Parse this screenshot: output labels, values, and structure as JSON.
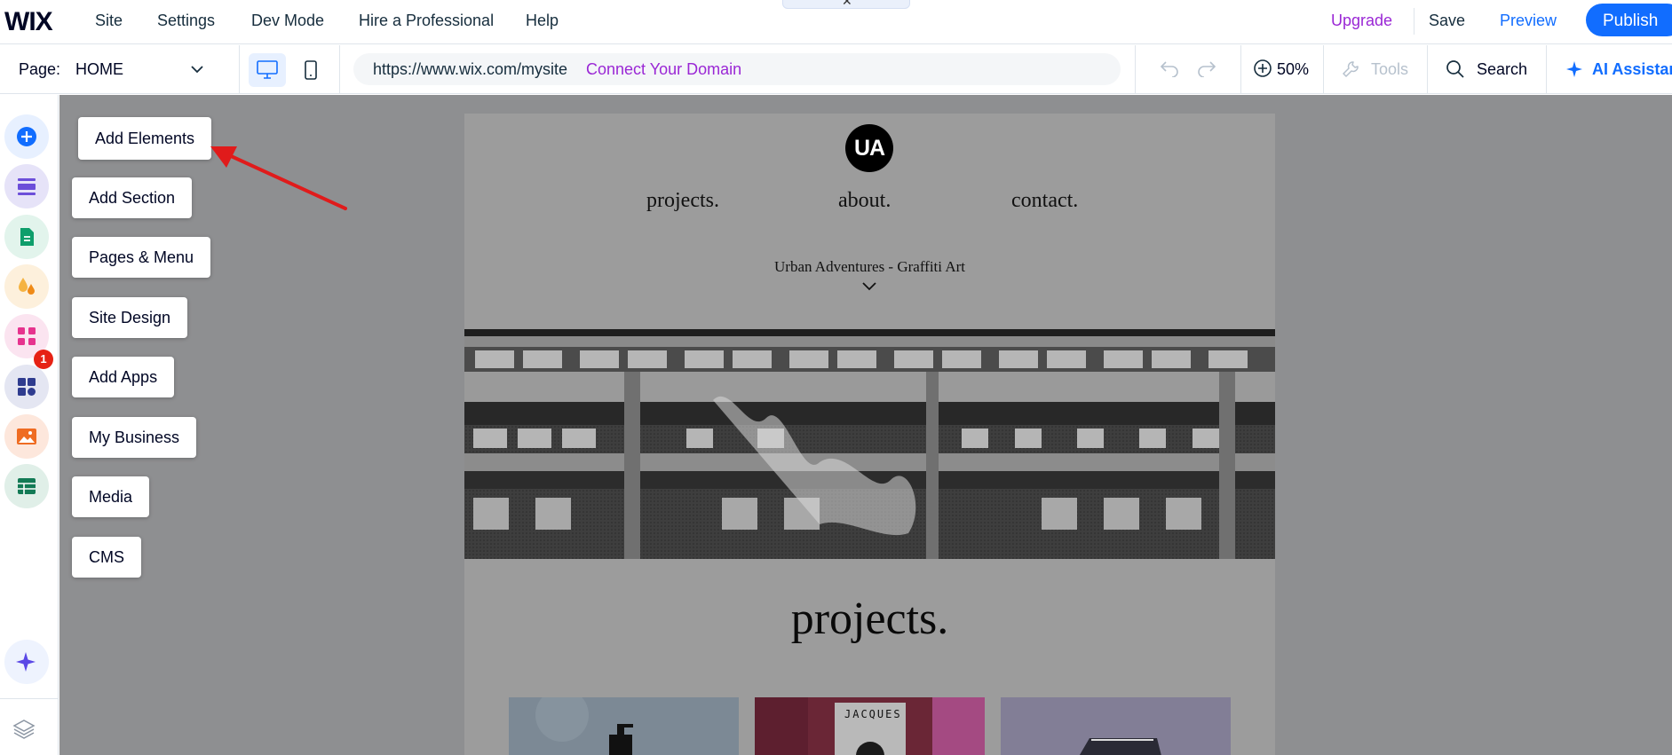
{
  "topbar": {
    "logo": "WIX",
    "menu": [
      "Site",
      "Settings",
      "Dev Mode",
      "Hire a Professional",
      "Help"
    ],
    "upgrade": "Upgrade",
    "save": "Save",
    "preview": "Preview",
    "publish": "Publish"
  },
  "toolbar": {
    "page_label": "Page:",
    "page_name": "HOME",
    "url": "https://www.wix.com/mysite",
    "connect_domain": "Connect Your Domain",
    "zoom": "50%",
    "tools": "Tools",
    "search": "Search",
    "ai_assistant": "AI Assistant"
  },
  "sidebar": {
    "items": [
      {
        "label": "Add Elements",
        "icon": "plus-circle-icon",
        "color": "#116dff"
      },
      {
        "label": "Add Section",
        "icon": "section-icon",
        "color": "#6c4ed9"
      },
      {
        "label": "Pages & Menu",
        "icon": "page-icon",
        "color": "#0e9e6b"
      },
      {
        "label": "Site Design",
        "icon": "paint-drops-icon",
        "color": "#f39c12"
      },
      {
        "label": "Add Apps",
        "icon": "apps-grid-icon",
        "color": "#e6338e"
      },
      {
        "label": "My Business",
        "icon": "business-puzzle-icon",
        "color": "#2f3c8f"
      },
      {
        "label": "Media",
        "icon": "image-icon",
        "color": "#ef6c22"
      },
      {
        "label": "CMS",
        "icon": "table-icon",
        "color": "#127a55"
      }
    ],
    "apps_badge": "1"
  },
  "site": {
    "logo_text": "UA",
    "nav": [
      "projects.",
      "about.",
      "contact."
    ],
    "tagline": "Urban Adventures - Graffiti Art",
    "section_title": "projects.",
    "thumb_label": "JACQUES"
  },
  "colors": {
    "accent": "#116dff",
    "upgrade": "#9a27d5",
    "annotation_arrow": "#e01b1b"
  }
}
